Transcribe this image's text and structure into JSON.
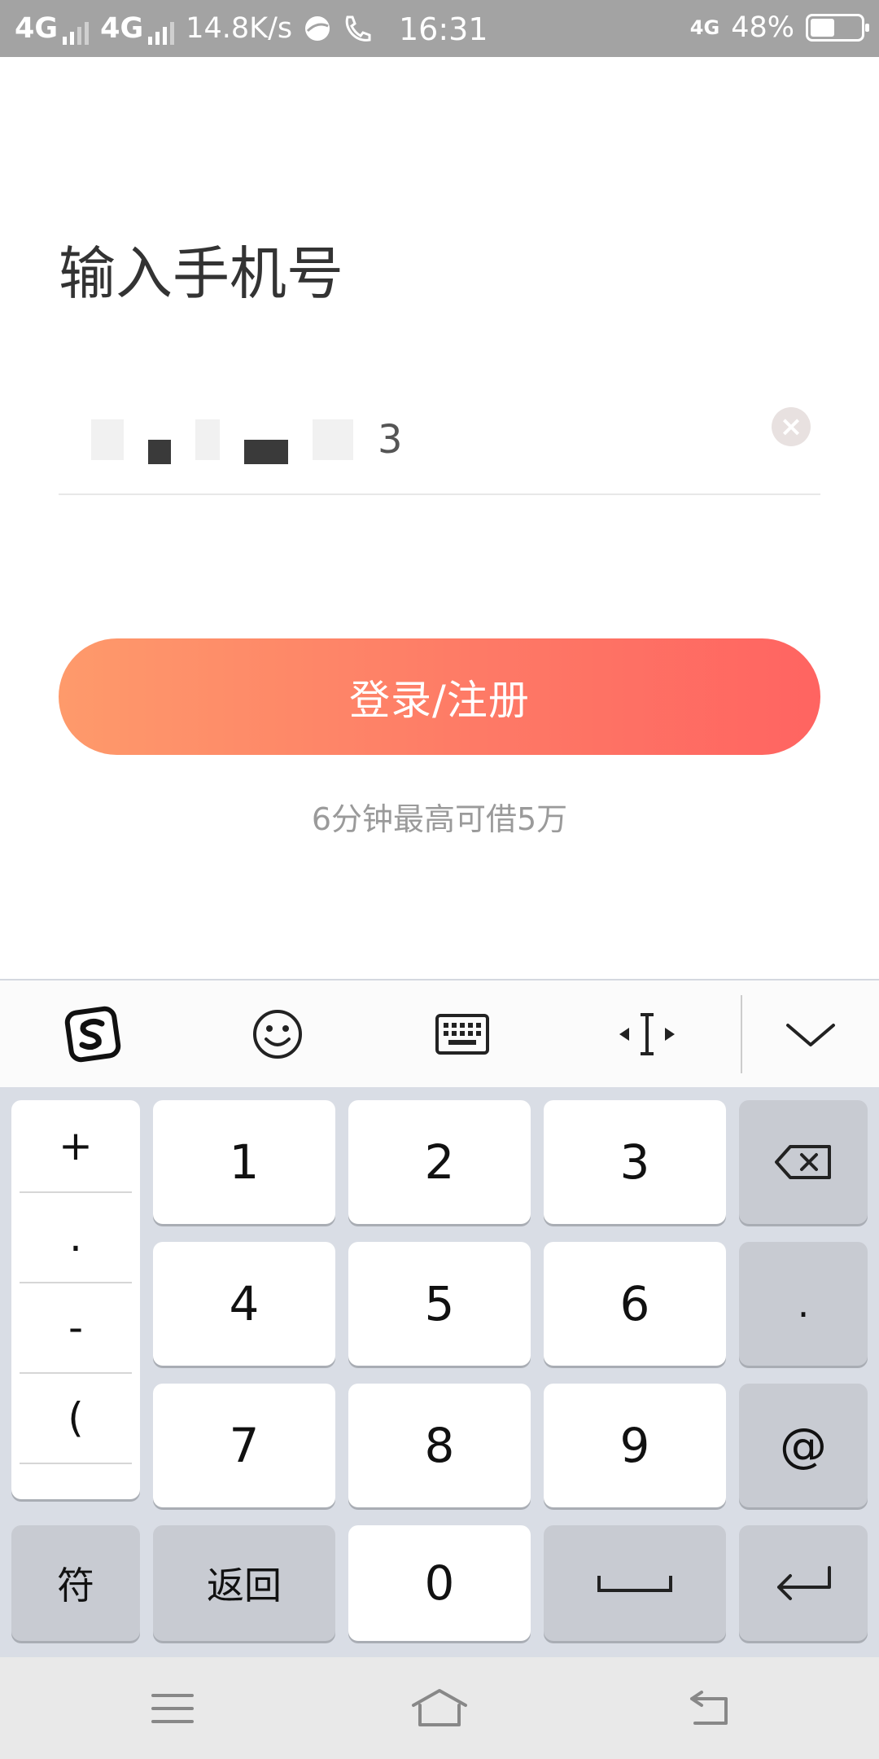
{
  "status_bar": {
    "network1": "4G",
    "network2": "4G",
    "speed": "14.8K/s",
    "time": "16:31",
    "net_type": "4G",
    "battery": "48%",
    "battery_level": 0.48
  },
  "page": {
    "title": "输入手机号",
    "phone_last_digit": "3",
    "login_button": "登录/注册",
    "tagline": "6分钟最高可借5万"
  },
  "keyboard": {
    "toolbar_icons": [
      "sogou-logo-icon",
      "emoji-icon",
      "keyboard-icon",
      "cursor-move-icon",
      "collapse-chevron-icon"
    ],
    "symbols": [
      "+",
      ".",
      "-",
      "("
    ],
    "digits": [
      "1",
      "2",
      "3",
      "4",
      "5",
      "6",
      "7",
      "8",
      "9",
      "0"
    ],
    "side_keys": [
      ".",
      "@"
    ],
    "fu_label": "符",
    "back_label": "返回"
  },
  "nav_bar": {
    "icons": [
      "menu-icon",
      "home-icon",
      "back-icon"
    ]
  }
}
